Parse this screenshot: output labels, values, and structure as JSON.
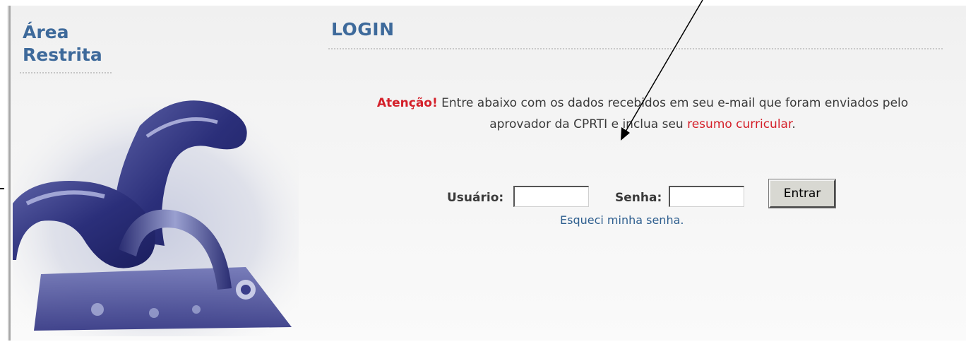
{
  "sidebar": {
    "title_line1": "Área",
    "title_line2": "Restrita"
  },
  "main": {
    "title": "LOGIN",
    "notice": {
      "warning": "Atenção!",
      "text_part1": " Entre abaixo com os dados recebidos em seu e-mail que foram enviados pelo aprovador da CPRTI e inclua seu ",
      "link_text": "resumo curricular",
      "text_end": "."
    }
  },
  "login_form": {
    "user_label": "Usuário:",
    "user_value": "",
    "password_label": "Senha:",
    "password_value": "",
    "submit_label": "Entrar",
    "forgot_label": "Esqueci minha senha."
  },
  "colors": {
    "heading": "#3e6a9b",
    "warning": "#d4202a",
    "link": "#2f5f8f"
  },
  "icons": {
    "sidebar_image": "padlock-chain-icon"
  }
}
